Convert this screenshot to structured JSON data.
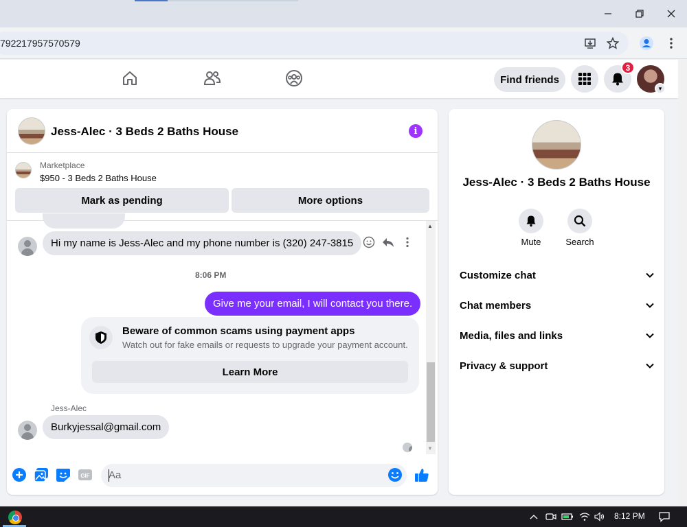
{
  "browser": {
    "url_fragment": "792217957570579"
  },
  "nav": {
    "find_friends": "Find friends",
    "notification_count": "3"
  },
  "chat": {
    "title": "Jess-Alec · 3 Beds 2 Baths House",
    "marketplace_label": "Marketplace",
    "listing": "$950 - 3 Beds 2 Baths House",
    "mark_pending": "Mark as pending",
    "more_options": "More options",
    "messages": [
      {
        "from": "them",
        "text": "Hi my name is Jess-Alec and my phone number is (320) 247-3815"
      },
      {
        "from": "me",
        "text": "Give me your email, I will contact you there."
      },
      {
        "from": "them",
        "sender": "Jess-Alec",
        "text": "Burkyjessal@gmail.com"
      }
    ],
    "time_separator": "8:06 PM",
    "scam_title": "Beware of common scams using payment apps",
    "scam_sub": "Watch out for fake emails or requests to upgrade your payment account.",
    "learn_more": "Learn More",
    "composer_placeholder": "Aa"
  },
  "info": {
    "title": "Jess-Alec · 3 Beds 2 Baths House",
    "mute": "Mute",
    "search": "Search",
    "rows": [
      "Customize chat",
      "Chat members",
      "Media, files and links",
      "Privacy & support"
    ]
  },
  "taskbar": {
    "time": "8:12 PM"
  },
  "colors": {
    "accent": "#7b2fff",
    "info_icon": "#a033ff",
    "messenger_blue": "#0a7cff",
    "badge": "#e41e3f"
  }
}
